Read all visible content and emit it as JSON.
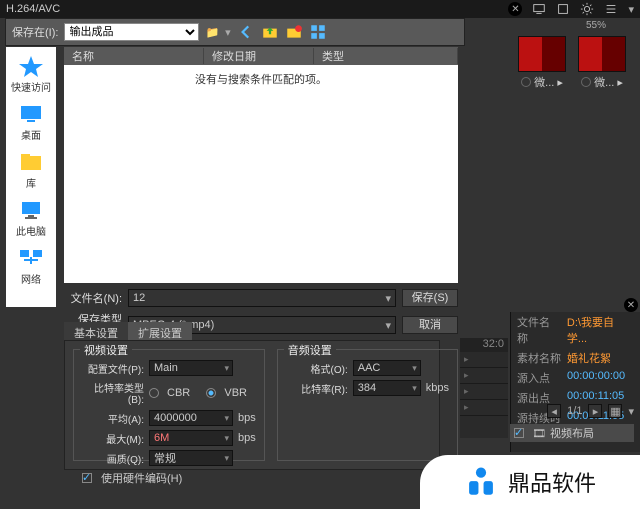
{
  "window": {
    "title": "H.264/AVC"
  },
  "zoom": "55%",
  "dialog": {
    "save_in_label": "保存在(I):",
    "save_in_value": "输出成品",
    "columns": {
      "name": "名称",
      "date": "修改日期",
      "type": "类型"
    },
    "empty_msg": "没有与搜索条件匹配的项。",
    "sidebar": [
      {
        "label": "快速访问"
      },
      {
        "label": "桌面"
      },
      {
        "label": "库"
      },
      {
        "label": "此电脑"
      },
      {
        "label": "网络"
      }
    ],
    "filename_label": "文件名(N):",
    "filename_value": "12",
    "filetype_label": "保存类型(T):",
    "filetype_value": "MPEG-4 (*.mp4)",
    "save_btn": "保存(S)",
    "cancel_btn": "取消"
  },
  "tabs": {
    "basic": "基本设置",
    "ext": "扩展设置"
  },
  "video": {
    "legend": "视频设置",
    "profile_label": "配置文件(P):",
    "profile_value": "Main",
    "rate_type_label": "比特率类型(B):",
    "cbr": "CBR",
    "vbr": "VBR",
    "avg_label": "平均(A):",
    "avg_value": "4000000",
    "bps": "bps",
    "max_label": "最大(M):",
    "max_value": "6M",
    "quality_label": "画质(Q):",
    "quality_value": "常规",
    "hw_label": "使用硬件编码(H)"
  },
  "audio": {
    "legend": "音频设置",
    "format_label": "格式(O):",
    "format_value": "AAC",
    "bitrate_label": "比特率(R):",
    "bitrate_value": "384",
    "kbps": "kbps"
  },
  "thumbs": [
    {
      "label": "微..."
    },
    {
      "label": "微..."
    }
  ],
  "props": {
    "file_k": "文件名称",
    "file_v": "D:\\我要自学...",
    "mat_k": "素材名称",
    "mat_v": "婚礼花絮",
    "in_k": "源入点",
    "in_v": "00:00:00:00",
    "out_k": "源出点",
    "out_v": "00:00:11:05",
    "dur_k": "源持续时间",
    "dur_v": "00:00:11:05"
  },
  "timeline": {
    "timecode": "32:0"
  },
  "paginator": {
    "page": "1/1"
  },
  "track": {
    "name": "视频布局"
  },
  "watermark": "鼎品软件"
}
